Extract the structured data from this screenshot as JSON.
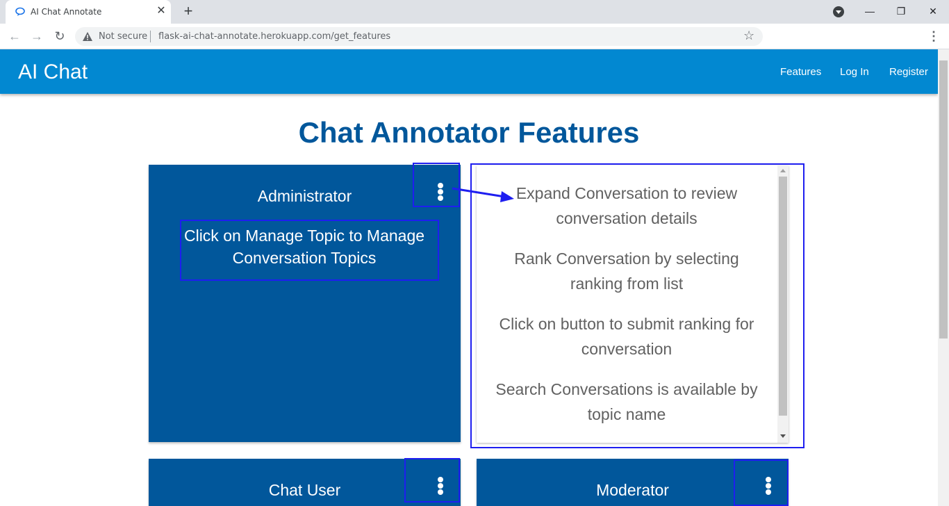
{
  "browser": {
    "tab_title": "AI Chat Annotate",
    "tab_close": "✕",
    "new_tab": "+",
    "not_secure": "Not secure",
    "url": "flask-ai-chat-annotate.herokuapp.com/get_features",
    "minimize": "—",
    "restore": "❐",
    "close": "✕",
    "back": "←",
    "forward": "→",
    "reload": "↻",
    "star": "☆",
    "menu": "⋮"
  },
  "navbar": {
    "brand": "AI Chat",
    "links": [
      "Features",
      "Log In",
      "Register"
    ]
  },
  "page": {
    "title": "Chat Annotator Features"
  },
  "cards": {
    "administrator": {
      "title": "Administrator",
      "description": "Click on Manage Topic to Manage Conversation Topics"
    },
    "chat_user": {
      "title": "Chat User"
    },
    "moderator": {
      "title": "Moderator"
    }
  },
  "reveal": {
    "items": [
      "Expand Conversation to review conversation details",
      "Rank Conversation by selecting ranking from list",
      "Click on button to submit ranking for conversation",
      "Search Conversations is available by topic name"
    ]
  },
  "colors": {
    "navbar": "#0288d1",
    "card": "#01579b",
    "heading": "#01579b",
    "highlight": "#1e1ef0"
  }
}
